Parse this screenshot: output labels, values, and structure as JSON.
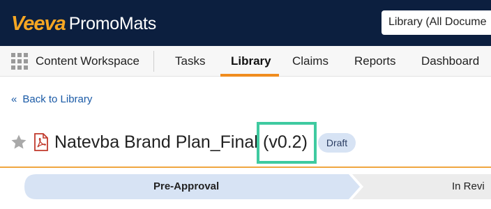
{
  "header": {
    "brand_veeva": "Veeva",
    "brand_product": "PromoMats",
    "search_value": "Library (All Docume"
  },
  "nav": {
    "workspace": "Content Workspace",
    "items": [
      {
        "label": "Tasks"
      },
      {
        "label": "Library",
        "active": true
      },
      {
        "label": "Claims"
      },
      {
        "label": "Reports"
      },
      {
        "label": "Dashboard"
      }
    ]
  },
  "breadcrumb": {
    "chevron": "«",
    "back_label": "Back to Library"
  },
  "document": {
    "title": "Natevba Brand Plan_Final",
    "version": "(v0.2)",
    "status": "Draft"
  },
  "lifecycle": {
    "stages": [
      {
        "label": "Pre-Approval",
        "active": true
      },
      {
        "label": "In Revi",
        "active": false
      }
    ]
  },
  "colors": {
    "header_bg": "#0c1f3f",
    "brand_accent": "#f5a623",
    "nav_active_underline": "#f08c1e",
    "highlight_box": "#3fcaa0",
    "badge_bg": "#d7e3f4",
    "stage_active": "#d7e3f4",
    "stage_inactive": "#ececec"
  },
  "icons": [
    "apps-grid-icon",
    "star-icon",
    "pdf-icon"
  ]
}
